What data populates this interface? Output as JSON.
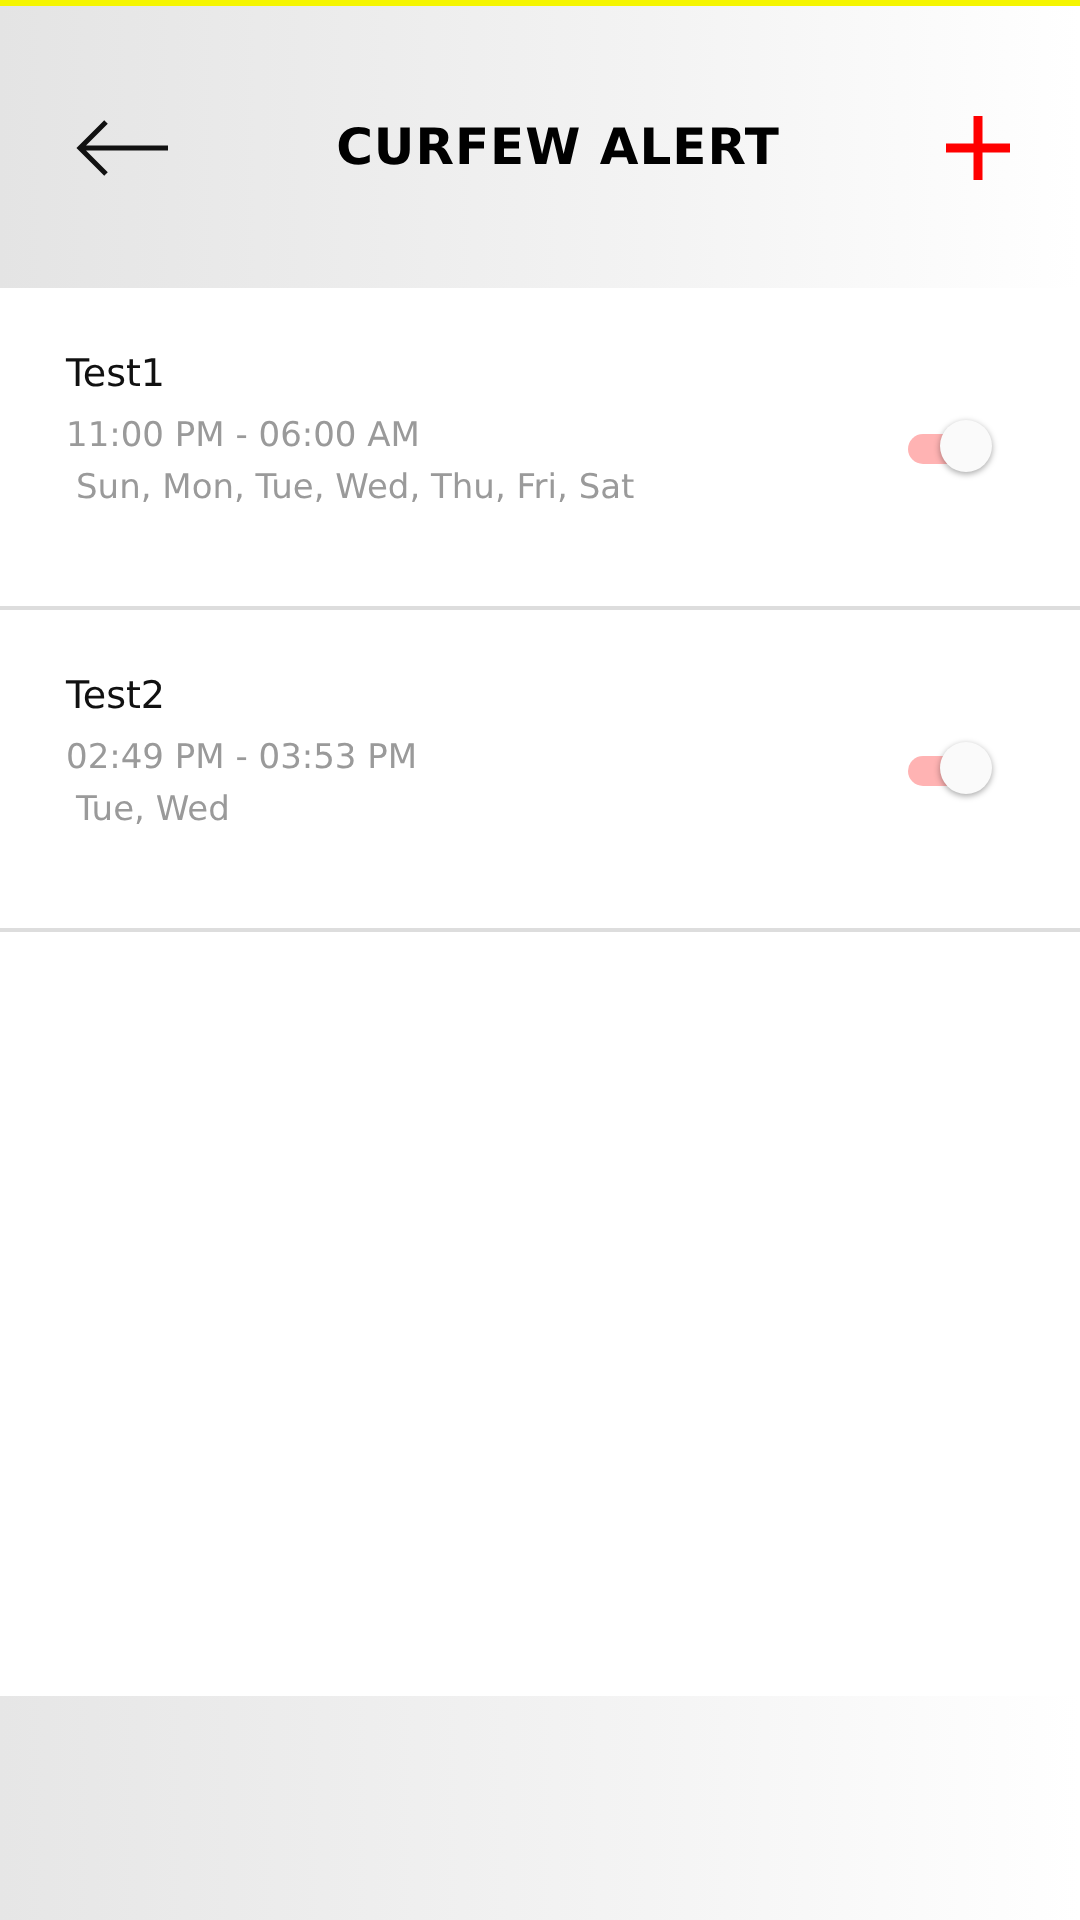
{
  "header": {
    "title": "CURFEW ALERT"
  },
  "alerts": [
    {
      "name": "Test1",
      "time": "11:00 PM - 06:00 AM",
      "days": "Sun, Mon, Tue, Wed, Thu, Fri, Sat",
      "on": true
    },
    {
      "name": "Test2",
      "time": "02:49 PM - 03:53 PM",
      "days": "Tue, Wed",
      "on": true
    }
  ]
}
